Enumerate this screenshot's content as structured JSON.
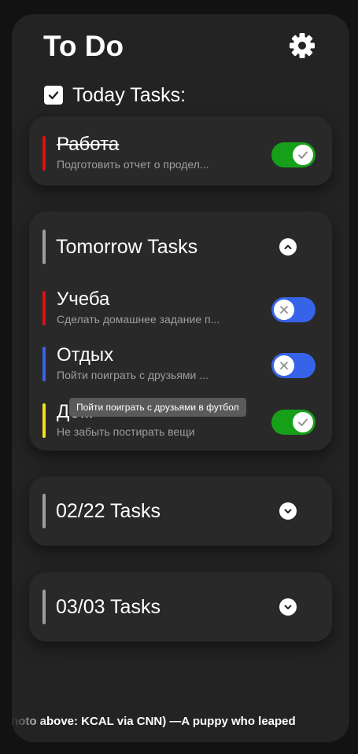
{
  "app": {
    "title": "To Do",
    "settings_icon": "gear-icon"
  },
  "today": {
    "label": "Today Tasks:",
    "checked": true,
    "tasks": [
      {
        "name": "Работа",
        "description": "Подготовить отчет о продел...",
        "color": "#e01010",
        "completed": true,
        "toggle": "on"
      }
    ]
  },
  "tomorrow": {
    "label": "Tomorrow Tasks",
    "expanded": true,
    "chevron_icon": "chevron-up-icon",
    "tasks": [
      {
        "name": "Учеба",
        "description": "Сделать домашнее задание п...",
        "color": "#e01010",
        "toggle": "off"
      },
      {
        "name": "Отдых",
        "description": "Пойти поиграть с друзьями ...",
        "color": "#3763e8",
        "toggle": "off"
      },
      {
        "name": "Дом",
        "description": "Не забыть постирать вещи",
        "color": "#f2e01a",
        "toggle": "on"
      }
    ]
  },
  "tooltip": {
    "text": "Пойти поиграть с друзьями в футбол"
  },
  "groups": [
    {
      "label": "02/22 Tasks",
      "expanded": false,
      "chevron_icon": "chevron-down-icon"
    },
    {
      "label": "03/03 Tasks",
      "expanded": false,
      "chevron_icon": "chevron-down-icon"
    }
  ],
  "ticker": {
    "text": "(Photo above: KCAL via CNN) —A puppy who leaped"
  },
  "colors": {
    "background": "#121212",
    "panel": "#232323",
    "card": "#292929",
    "toggle_on": "#16a019",
    "toggle_off": "#3763e8"
  }
}
